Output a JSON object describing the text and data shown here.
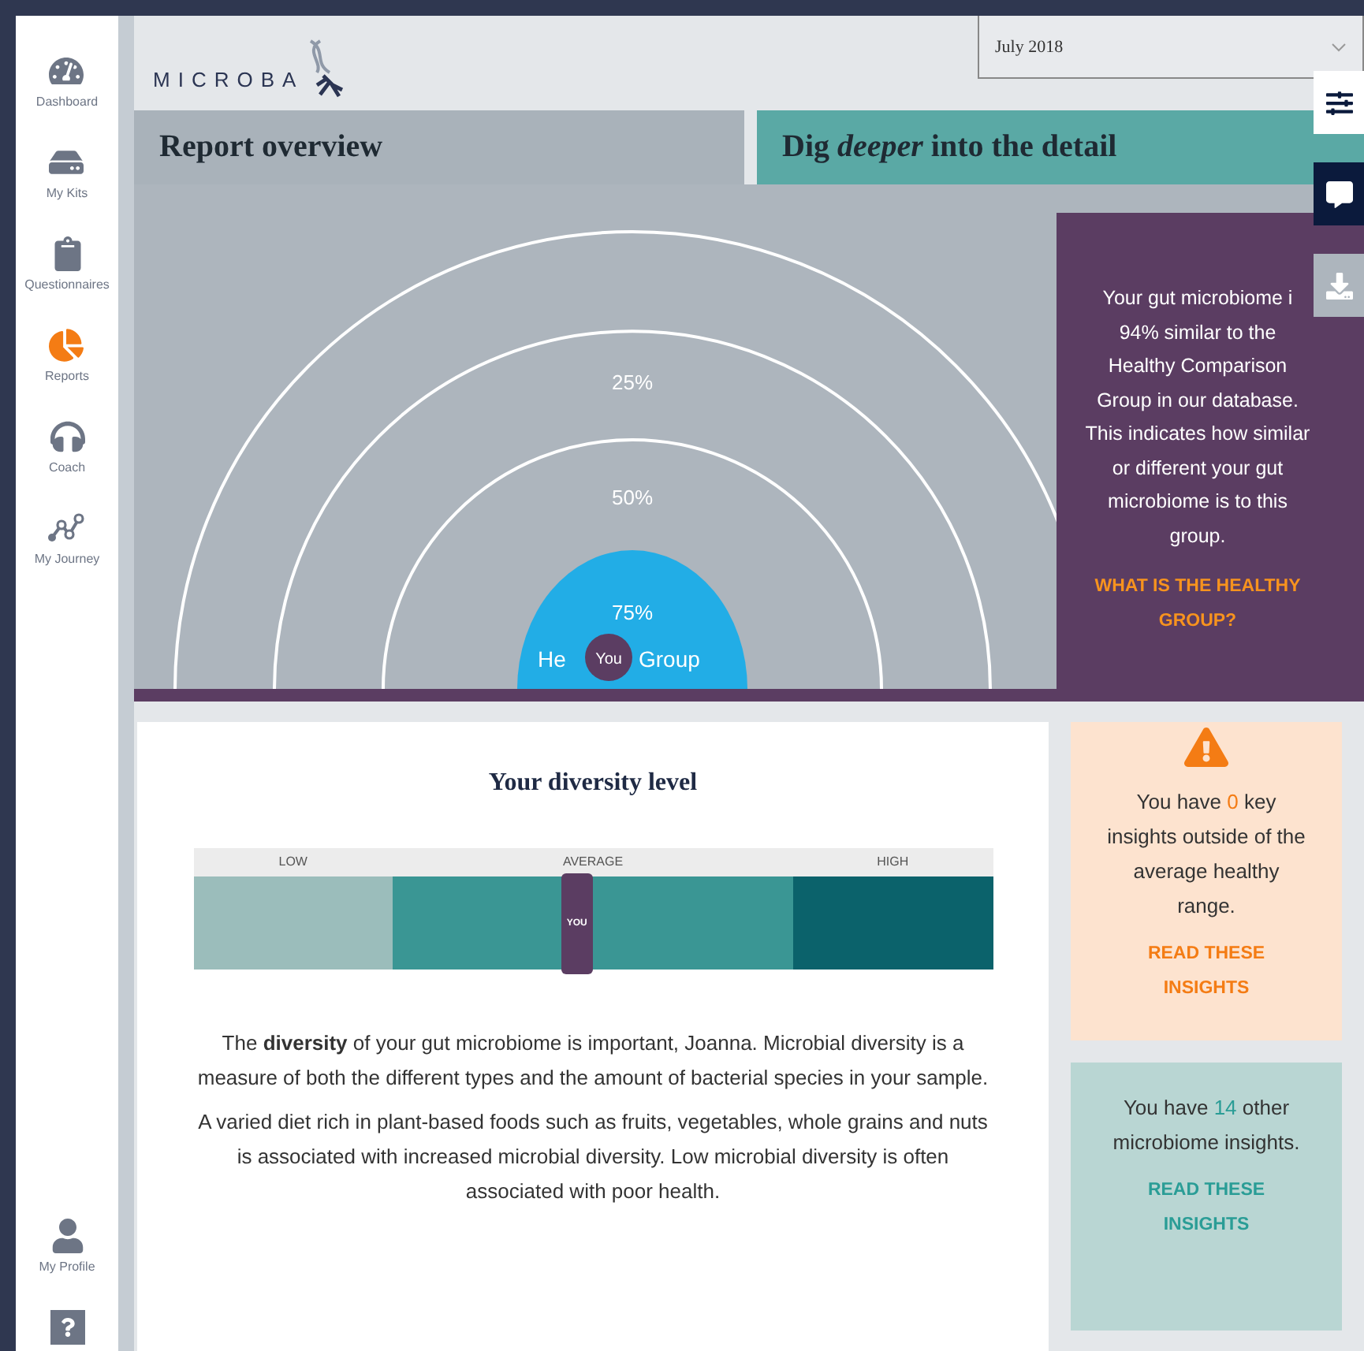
{
  "sidebar": {
    "items": [
      {
        "label": "Dashboard",
        "selected": false
      },
      {
        "label": "My Kits",
        "selected": false
      },
      {
        "label": "Questionnaires",
        "selected": false
      },
      {
        "label": "Reports",
        "selected": true
      },
      {
        "label": "Coach",
        "selected": false
      },
      {
        "label": "My Journey",
        "selected": false
      }
    ],
    "bottom_items": [
      {
        "label": "My Profile"
      }
    ]
  },
  "header": {
    "logo": "MICROBA",
    "date_select": {
      "value": "July 2018"
    }
  },
  "tabs": [
    {
      "label": "Report overview",
      "selected": true
    },
    {
      "label": "Dig **deeper** into the detail",
      "selected": false
    }
  ],
  "overview": {
    "ring_labels": [
      "25%",
      "50%",
      "75%"
    ],
    "group_label_parts": [
      "He",
      "Group"
    ],
    "you_marker": "You",
    "summary": "Your gut microbiome i 94% similar to the Healthy Comparison Group in our database. This indicates how similar or different your gut microbiome is to this group.",
    "link": "WHAT IS THE HEALTHY GROUP?"
  },
  "diversity": {
    "title": "Your diversity level",
    "bands": [
      {
        "label": "LOW",
        "color": "#9bbdbb"
      },
      {
        "label": "AVERAGE",
        "color": "#3a9694"
      },
      {
        "label": "HIGH",
        "color": "#0b626b"
      }
    ],
    "marker": {
      "label": "YOU",
      "level": 0.48
    },
    "paragraphs": [
      "The **diversity** of your gut microbiome is important, Joanna. Microbial diversity is a measure of both the different types and the amount of bacterial species in your sample.",
      "A varied diet rich in plant-based foods such as fruits, vegetables, whole grains and nuts is associated with increased microbial diversity. Low microbial diversity is often associated with poor health."
    ]
  },
  "insight_cards": [
    {
      "kind": "warning",
      "before": "You have",
      "count": "0",
      "after": "key insights outside of the average healthy range.",
      "link": "READ THESE INSIGHTS"
    },
    {
      "kind": "info",
      "before": "You have",
      "count": "14",
      "after": "other microbiome insights.",
      "link": "READ THESE INSIGHTS"
    }
  ]
}
